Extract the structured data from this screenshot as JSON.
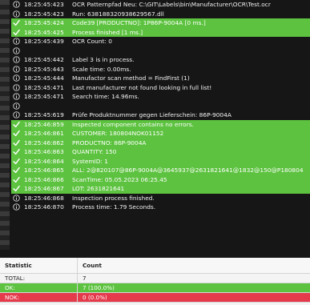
{
  "log_rows": [
    {
      "icon": "info",
      "green": false,
      "time": "18:25:45:423",
      "msg": "OCR Patternpfad Neu: C:\\GIT\\Labels\\bin\\Manufacturer\\OCR\\Test.ocr"
    },
    {
      "icon": "info",
      "green": false,
      "time": "18:25:45:423",
      "msg": "Run: 638188320938629567.dll"
    },
    {
      "icon": "check",
      "green": true,
      "time": "18:25:45:424",
      "msg": "Code39 [PRODUCTNO]: 1P86P-9004A [0 ms.]"
    },
    {
      "icon": "check",
      "green": true,
      "time": "18:25:45:425",
      "msg": "Process finished [1 ms.]"
    },
    {
      "icon": "info",
      "green": false,
      "time": "18:25:45:439",
      "msg": "OCR Count: 0"
    },
    {
      "icon": "info",
      "green": false,
      "time": "",
      "msg": ""
    },
    {
      "icon": "info",
      "green": false,
      "time": "18:25:45:442",
      "msg": "Label 3 is in process."
    },
    {
      "icon": "info",
      "green": false,
      "time": "18:25:45:443",
      "msg": "Scale time: 0.00ms."
    },
    {
      "icon": "info",
      "green": false,
      "time": "18:25:45:444",
      "msg": "Manufactor scan method = FindFirst (1)"
    },
    {
      "icon": "info",
      "green": false,
      "time": "18:25:45:471",
      "msg": "Last manufacturer not found looking in full list!"
    },
    {
      "icon": "info",
      "green": false,
      "time": "18:25:45:471",
      "msg": "Search time: 14.96ms."
    },
    {
      "icon": "info",
      "green": false,
      "time": "",
      "msg": ""
    },
    {
      "icon": "info",
      "green": false,
      "time": "18:25:45:619",
      "msg": "Prüfe Produktnummer gegen Lieferschein: 86P-9004A"
    },
    {
      "icon": "check",
      "green": true,
      "time": "18:25:46:859",
      "msg": "Inspected component contains no errors."
    },
    {
      "icon": "check",
      "green": true,
      "time": "18:25:46:861",
      "msg": "CUSTOMER:  180804NOK01152"
    },
    {
      "icon": "check",
      "green": true,
      "time": "18:25:46:862",
      "msg": "PRODUCTNO:  86P-9004A"
    },
    {
      "icon": "check",
      "green": true,
      "time": "18:25:46:863",
      "msg": "QUANTITY:  150"
    },
    {
      "icon": "check",
      "green": true,
      "time": "18:25:46:864",
      "msg": "SystemID:  1"
    },
    {
      "icon": "check",
      "green": true,
      "time": "18:25:46:865",
      "msg": "ALL:  2@820107@86P-9004A@3645937@2631821641@1832@150@P180804"
    },
    {
      "icon": "check",
      "green": true,
      "time": "18:25:46:866",
      "msg": "ScanTime:  05.05.2023 06:25.45"
    },
    {
      "icon": "check",
      "green": true,
      "time": "18:25:46:867",
      "msg": "LOT:  2631821641"
    },
    {
      "icon": "info",
      "green": false,
      "time": "18:25:46:868",
      "msg": "Inspection process finished."
    },
    {
      "icon": "info",
      "green": false,
      "time": "18:25:46:870",
      "msg": "Process time: 1.79 Seconds."
    }
  ],
  "stats": {
    "header": {
      "statistic": "Statistic",
      "count": "Count"
    },
    "rows": [
      {
        "kind": "total",
        "label": "TOTAL:",
        "count": "7"
      },
      {
        "kind": "ok",
        "label": "OK:",
        "count": "7       (100.0%)"
      },
      {
        "kind": "nok",
        "label": "NOK:",
        "count": "0       (0.0%)"
      }
    ]
  },
  "colors": {
    "ok_green": "#5cc23f",
    "nok_red": "#e53a4c",
    "log_background": "#161616"
  }
}
